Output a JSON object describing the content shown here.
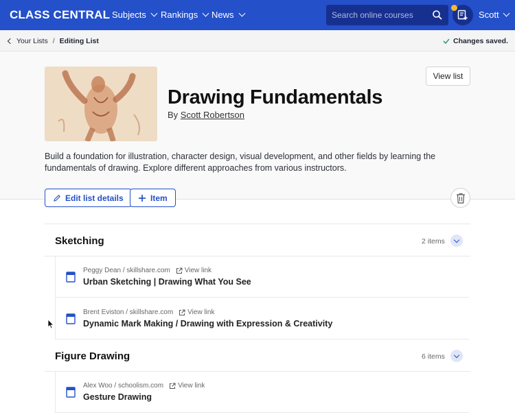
{
  "nav": {
    "logo": "CLASS CENTRAL",
    "links": [
      "Subjects",
      "Rankings",
      "News"
    ],
    "search_placeholder": "Search online courses",
    "user": "Scott",
    "brand_color": "#2450c9",
    "icons": [
      "search-icon",
      "list-add-icon",
      "chevron-down-icon"
    ]
  },
  "breadcrumb": {
    "parent": "Your Lists",
    "separator": "/",
    "current": "Editing List",
    "status": "Changes saved."
  },
  "list": {
    "title": "Drawing Fundamentals",
    "by_prefix": "By",
    "author": "Scott Robertson",
    "description": "Build a foundation for illustration, character design, visual development, and other fields by learning the fundamentals of drawing. Explore different approaches from various instructors.",
    "view_list_label": "View list",
    "edit_label": "Edit list details",
    "add_item_label": "Item"
  },
  "sections": [
    {
      "title": "Sketching",
      "count": "2 items",
      "items": [
        {
          "meta": "Peggy Dean / skillshare.com",
          "link": "View link",
          "title": "Urban Sketching | Drawing What You See"
        },
        {
          "meta": "Brent Eviston / skillshare.com",
          "link": "View link",
          "title": "Dynamic Mark Making / Drawing with Expression & Creativity"
        }
      ]
    },
    {
      "title": "Figure Drawing",
      "count": "6 items",
      "items": [
        {
          "meta": "Alex Woo / schoolism.com",
          "link": "View link",
          "title": "Gesture Drawing"
        }
      ]
    }
  ]
}
